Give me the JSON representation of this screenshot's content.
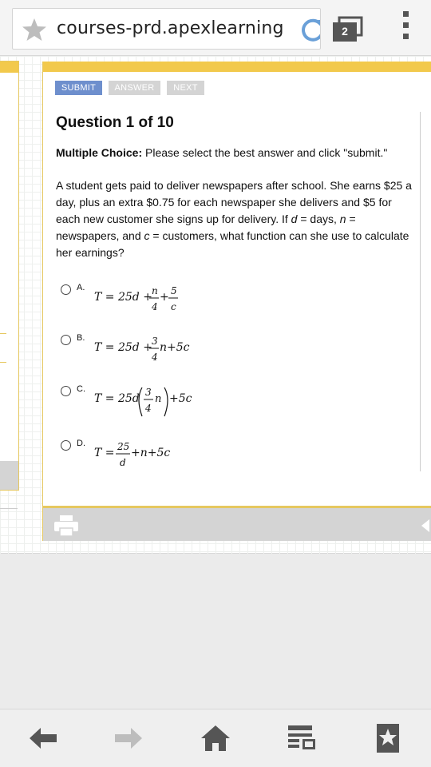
{
  "browser": {
    "url": "courses-prd.apexlearning",
    "tab_count": "2"
  },
  "toolbar": {
    "submit_label": "SUBMIT",
    "answer_label": "ANSWER",
    "next_label": "NEXT"
  },
  "question": {
    "title": "Question 1 of 10",
    "instruction_bold": "Multiple Choice:",
    "instruction_text": "Please select the best answer and click \"submit.\"",
    "prompt_part1": "A student gets paid to deliver newspapers after school. She earns $25 a day, plus an extra $0.75 for each newspaper she delivers and $5 for each new customer she signs up for delivery. If ",
    "var_d": "d",
    "prompt_part2": " = days, ",
    "var_n": "n",
    "prompt_part3": " = newspapers, and ",
    "var_c": "c",
    "prompt_part4": " = customers, what function can she use to calculate her earnings?"
  },
  "choices": [
    {
      "letter": "A."
    },
    {
      "letter": "B."
    },
    {
      "letter": "C."
    },
    {
      "letter": "D."
    }
  ],
  "formulas": {
    "a": {
      "lhs": "T = 25d +",
      "num1": "n",
      "den1": "4",
      "plus": "+",
      "num2": "5",
      "den2": "c"
    },
    "b": {
      "lhs": "T = 25d +",
      "num": "3",
      "den": "4",
      "rest": "n+5c"
    },
    "c": {
      "lhs": "T = 25d",
      "num": "3",
      "den": "4",
      "var": "n",
      "rest": "+5c"
    },
    "d": {
      "lhs": "T =",
      "num": "25",
      "den": "d",
      "rest": "+n+5c"
    }
  },
  "colors": {
    "accent_yellow": "#f2c94c",
    "submit_blue": "#6e8fcd",
    "disabled_gray": "#d4d4d4"
  }
}
